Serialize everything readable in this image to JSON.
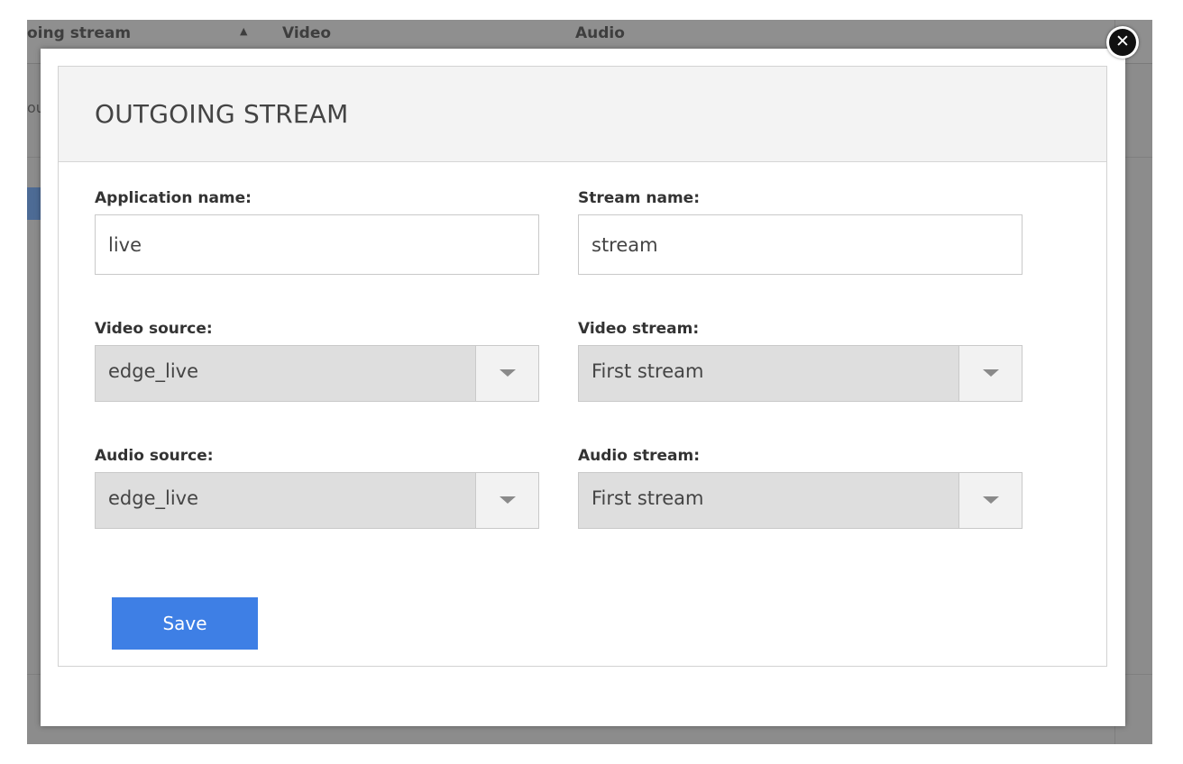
{
  "background_table": {
    "columns": [
      {
        "label": "oing stream"
      },
      {
        "label": "Video"
      },
      {
        "label": "Audio"
      }
    ],
    "sort_indicator": "▲",
    "row_snippet": "ou"
  },
  "dialog": {
    "title": "OUTGOING STREAM",
    "close_icon": "close-icon",
    "fields": {
      "application_name": {
        "label": "Application name:",
        "value": "live"
      },
      "stream_name": {
        "label": "Stream name:",
        "value": "stream"
      },
      "video_source": {
        "label": "Video source:",
        "value": "edge_live"
      },
      "video_stream": {
        "label": "Video stream:",
        "value": "First stream"
      },
      "audio_source": {
        "label": "Audio source:",
        "value": "edge_live"
      },
      "audio_stream": {
        "label": "Audio stream:",
        "value": "First stream"
      }
    },
    "save_label": "Save"
  },
  "colors": {
    "accent": "#3e7fe5",
    "overlay": "#8c8c8c",
    "select_bg": "#dedede",
    "header_bg": "#f3f3f3"
  }
}
